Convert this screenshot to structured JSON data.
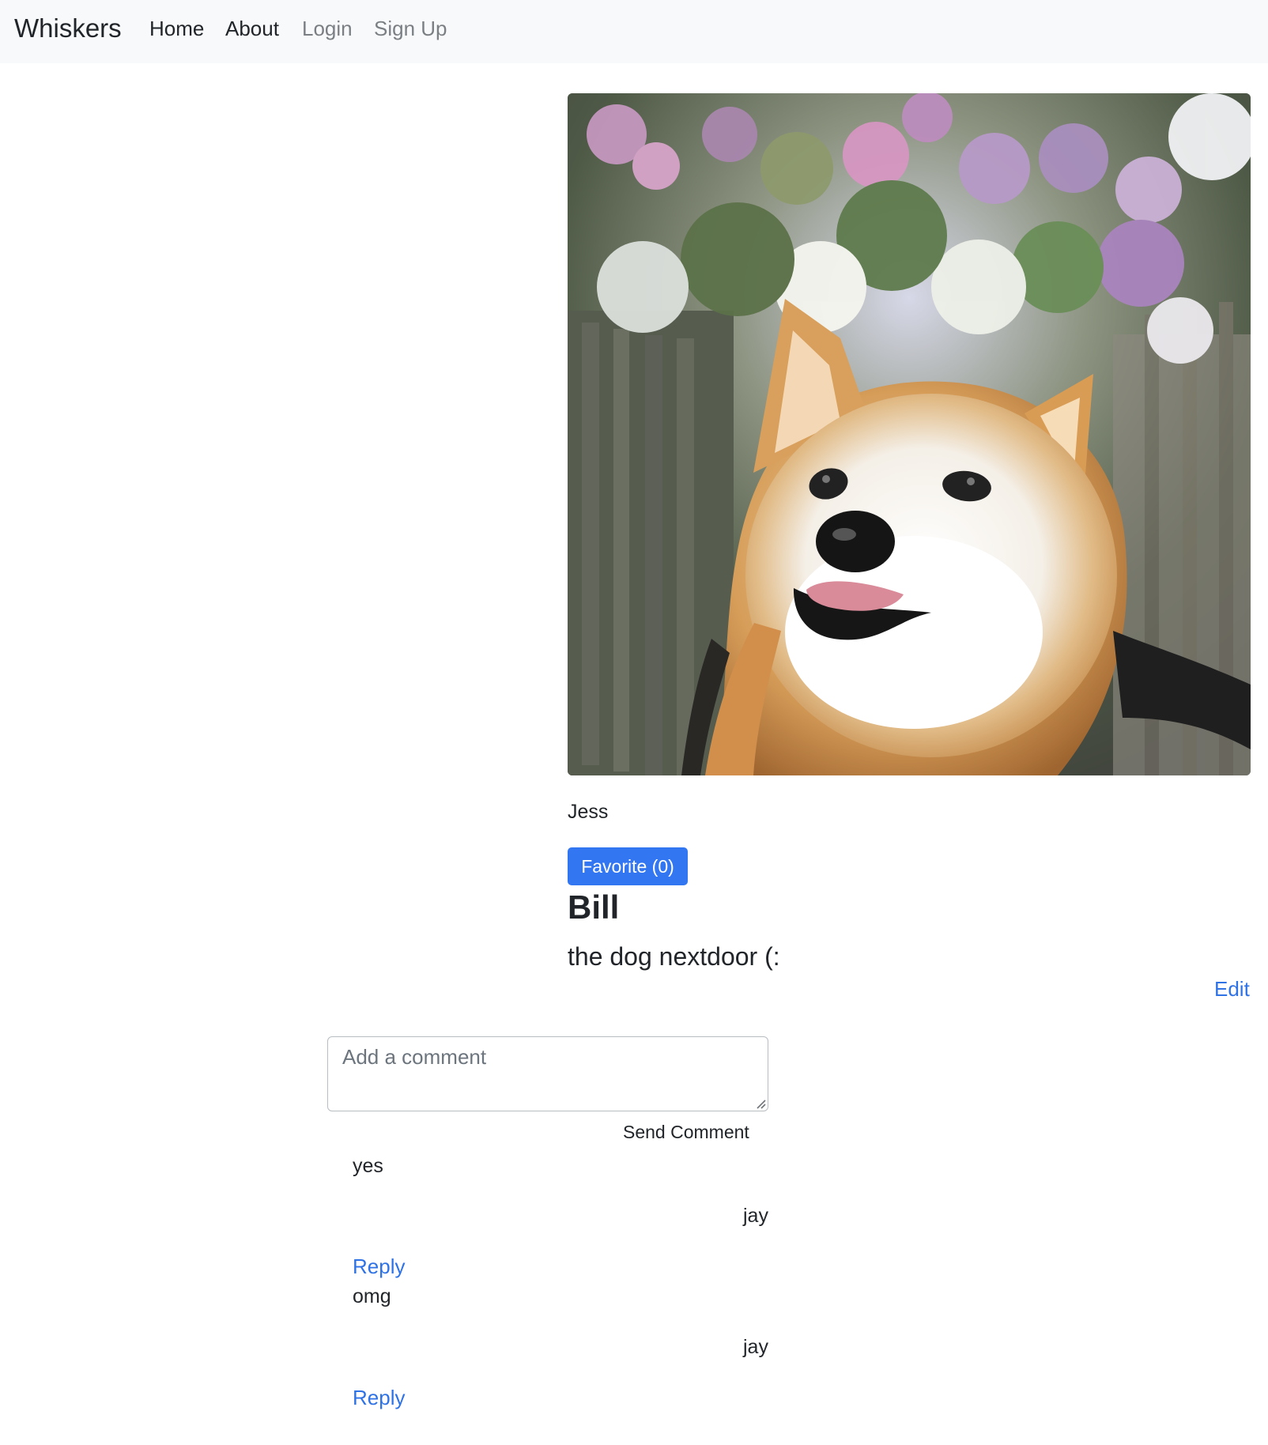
{
  "nav": {
    "brand": "Whiskers",
    "links": [
      {
        "label": "Home"
      },
      {
        "label": "About"
      },
      {
        "label": "Login"
      },
      {
        "label": "Sign Up"
      }
    ]
  },
  "post": {
    "image_subject": "shiba-inu-dog-photo",
    "author": "Jess",
    "favorite_label": "Favorite (0)",
    "title": "Bill",
    "description": "the dog nextdoor (:",
    "edit_label": "Edit"
  },
  "comment_form": {
    "placeholder": "Add a comment",
    "value": "",
    "send_label": "Send Comment"
  },
  "comments": [
    {
      "text": "yes",
      "author": "jay",
      "reply_label": "Reply"
    },
    {
      "text": "omg",
      "author": "jay",
      "reply_label": "Reply"
    }
  ],
  "colors": {
    "navbar_background": "#f8f9fa",
    "primary_button": "#3277f1",
    "link": "#2f72e5",
    "muted_nav_link": "#7b7f84",
    "body_text": "#212529"
  }
}
